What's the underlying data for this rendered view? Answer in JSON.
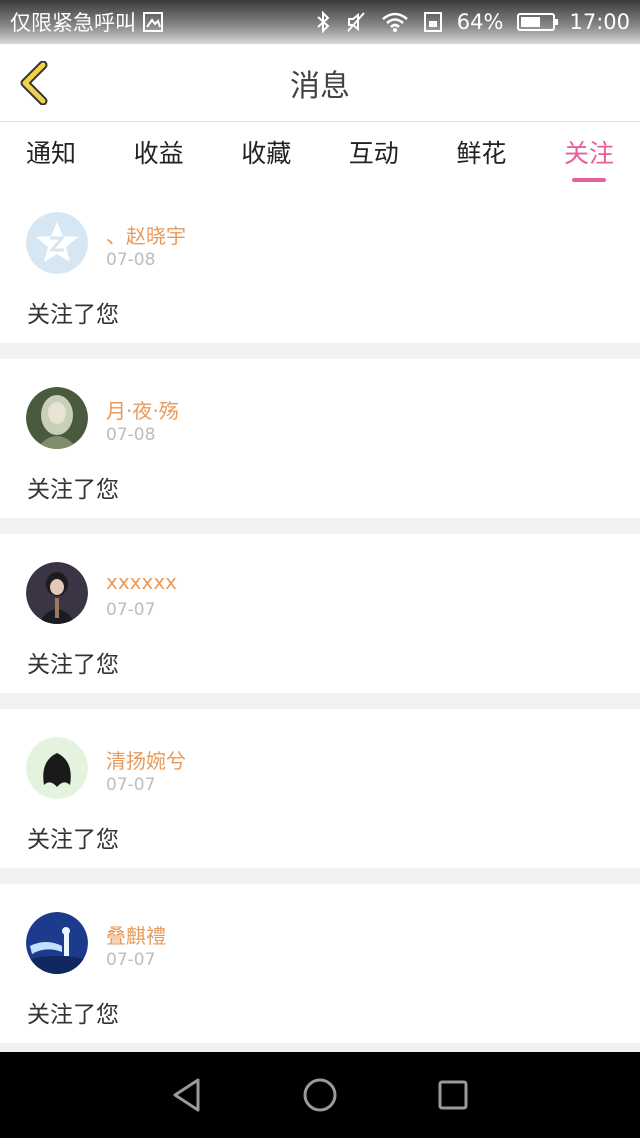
{
  "status_bar": {
    "carrier_text": "仅限紧急呼叫",
    "battery_percent": "64%",
    "battery_level": 0.64,
    "time": "17:00",
    "icons": [
      "image-icon",
      "bluetooth-icon",
      "mute-icon",
      "wifi-icon",
      "sim-icon",
      "battery-icon"
    ]
  },
  "header": {
    "title": "消息",
    "back_icon": "chevron-left-icon",
    "accent": "#f1d24a"
  },
  "tabs": [
    {
      "label": "通知",
      "active": false
    },
    {
      "label": "收益",
      "active": false
    },
    {
      "label": "收藏",
      "active": false
    },
    {
      "label": "互动",
      "active": false
    },
    {
      "label": "鲜花",
      "active": false
    },
    {
      "label": "关注",
      "active": true
    }
  ],
  "colors": {
    "active_tab": "#e8609a",
    "username": "#e89a5c",
    "date": "#bdbdbd"
  },
  "items": [
    {
      "name": "、赵晓宇",
      "date": "07-08",
      "message": "关注了您"
    },
    {
      "name": "月·夜·殇",
      "date": "07-08",
      "message": "关注了您"
    },
    {
      "name": "xxxxxx",
      "date": "07-07",
      "message": "关注了您"
    },
    {
      "name": "清扬婉兮",
      "date": "07-07",
      "message": "关注了您"
    },
    {
      "name": "叠麒禮",
      "date": "07-07",
      "message": "关注了您"
    }
  ],
  "nav_bar": {
    "icons": [
      "back-triangle-icon",
      "home-circle-icon",
      "recents-square-icon"
    ]
  }
}
